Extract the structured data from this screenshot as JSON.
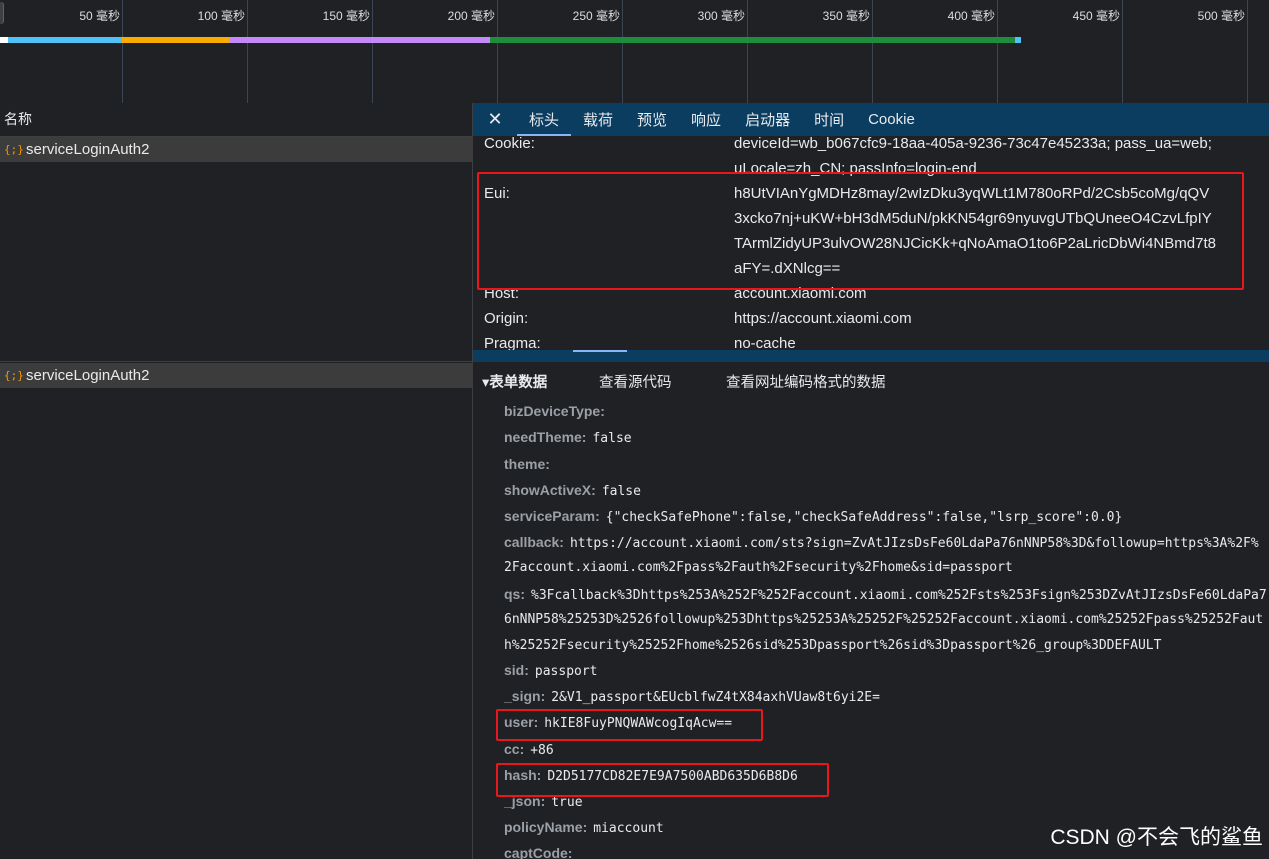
{
  "timeline": {
    "ticks": [
      "50 毫秒",
      "100 毫秒",
      "150 毫秒",
      "200 毫秒",
      "250 毫秒",
      "300 毫秒",
      "350 毫秒",
      "400 毫秒",
      "450 毫秒",
      "500 毫秒"
    ],
    "segment_colors": [
      "#4fc3f7",
      "#f9ab00",
      "#c58af9",
      "#1e8e3e"
    ]
  },
  "requests": {
    "column_header": "名称",
    "items": [
      {
        "icon": "{;}",
        "name": "serviceLoginAuth2"
      },
      {
        "icon": "{;}",
        "name": "serviceLoginAuth2"
      }
    ]
  },
  "detail_tabs": {
    "close": "✕",
    "items": [
      "标头",
      "载荷",
      "预览",
      "响应",
      "启动器",
      "时间",
      "Cookie"
    ],
    "active": "标头"
  },
  "headers": [
    {
      "name": "Cookie:",
      "value": "deviceId=wb_b067cfc9-18aa-405a-9236-73c47e45233a; pass_ua=web; uLocale=zh_CN; passInfo=login-end"
    },
    {
      "name": "Eui:",
      "value": "h8UtVIAnYgMDHz8may/2wIzDku3yqWLt1M780oRPd/2Csb5coMg/qQV3xcko7nj+uKW+bH3dM5duN/pkKN54gr69nyuvgUTbQUneeO4CzvLfpIYTArmlZidyUP3ulvOW28NJCicKk+qNoAmaO1to6P2aLricDbWi4NBmd7t8aFY=.dXNlcg=="
    },
    {
      "name": "Host:",
      "value": "account.xiaomi.com"
    },
    {
      "name": "Origin:",
      "value": "https://account.xiaomi.com"
    },
    {
      "name": "Pragma:",
      "value": "no-cache"
    }
  ],
  "payload": {
    "section_title": "▾表单数据",
    "view_source": "查看源代码",
    "view_url_encoded": "查看网址编码格式的数据",
    "fields": [
      {
        "key": "bizDeviceType:",
        "value": ""
      },
      {
        "key": "needTheme:",
        "value": "false"
      },
      {
        "key": "theme:",
        "value": ""
      },
      {
        "key": "showActiveX:",
        "value": "false"
      },
      {
        "key": "serviceParam:",
        "value": "{\"checkSafePhone\":false,\"checkSafeAddress\":false,\"lsrp_score\":0.0}"
      },
      {
        "key": "callback:",
        "value": "https://account.xiaomi.com/sts?sign=ZvAtJIzsDsFe60LdaPa76nNNP58%3D&followup=https%3A%2F%2Faccount.xiaomi.com%2Fpass%2Fauth%2Fsecurity%2Fhome&sid=passport"
      },
      {
        "key": "qs:",
        "value": "%3Fcallback%3Dhttps%253A%252F%252Faccount.xiaomi.com%252Fsts%253Fsign%253DZvAtJIzsDsFe60LdaPa76nNNP58%25253D%2526followup%253Dhttps%25253A%25252F%25252Faccount.xiaomi.com%25252Fpass%25252Fauth%25252Fsecurity%25252Fhome%2526sid%253Dpassport%26sid%3Dpassport%26_group%3DDEFAULT"
      },
      {
        "key": "sid:",
        "value": "passport"
      },
      {
        "key": "_sign:",
        "value": "2&V1_passport&EUcblfwZ4tX84axhVUaw8t6yi2E="
      },
      {
        "key": "user:",
        "value": "hkIE8FuyPNQWAWcogIqAcw=="
      },
      {
        "key": "cc:",
        "value": "+86"
      },
      {
        "key": "hash:",
        "value": "D2D5177CD82E7E9A7500ABD635D6B8D6"
      },
      {
        "key": "_json:",
        "value": "true"
      },
      {
        "key": "policyName:",
        "value": "miaccount"
      },
      {
        "key": "captCode:",
        "value": ""
      }
    ],
    "wrapped": {
      "callback_line1": "https://account.xiaomi.com/sts?sign=ZvAtJIzsDsFe60LdaPa76nNNP58%3D&followup=https%3A%2F%",
      "callback_line2": "2Faccount.xiaomi.com%2Fpass%2Fauth%2Fsecurity%2Fhome&sid=passport",
      "qs_line1": "%3Fcallback%3Dhttps%253A%252F%252Faccount.xiaomi.com%252Fsts%253Fsign%253DZvAtJIzsDsFe60LdaPa7",
      "qs_line2": "6nNNP58%25253D%2526followup%253Dhttps%25253A%25252F%25252Faccount.xiaomi.com%25252Fpass%25252Faut",
      "qs_line3": "h%25252Fsecurity%25252Fhome%2526sid%253Dpassport%26sid%3Dpassport%26_group%3DDEFAULT"
    }
  },
  "eui_wrapped": [
    "h8UtVIAnYgMDHz8may/2wIzDku3yqWLt1M780oRPd/2Csb5coMg/qQV",
    "3xcko7nj+uKW+bH3dM5duN/pkKN54gr69nyuvgUTbQUneeO4CzvLfpIY",
    "TArmlZidyUP3ulvOW28NJCicKk+qNoAmaO1to6P2aLricDbWi4NBmd7t8",
    "aFY=.dXNlcg=="
  ],
  "cookie_wrapped": [
    "deviceId=wb_b067cfc9-18aa-405a-9236-73c47e45233a; pass_ua=web;",
    "uLocale=zh_CN; passInfo=login-end"
  ],
  "watermark": "CSDN @不会飞的鲨鱼",
  "highlight_color": "#e8171b"
}
